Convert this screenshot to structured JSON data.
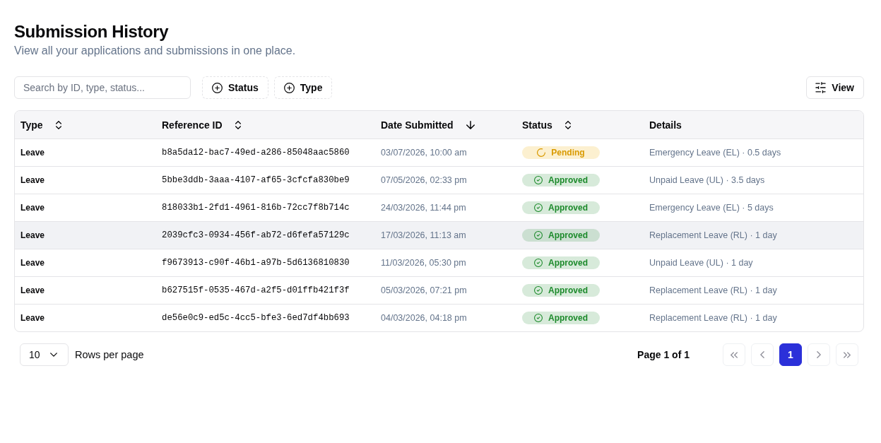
{
  "page": {
    "title": "Submission History",
    "subtitle": "View all your applications and submissions in one place."
  },
  "toolbar": {
    "search": {
      "placeholder": "Search by ID, type, status..."
    },
    "filters": [
      {
        "label": "Status"
      },
      {
        "label": "Type"
      }
    ],
    "view_button": {
      "label": "View"
    }
  },
  "table": {
    "columns": [
      {
        "label": "Type",
        "sortable": true,
        "sorted": false
      },
      {
        "label": "Reference ID",
        "sortable": true,
        "sorted": false
      },
      {
        "label": "Date Submitted",
        "sortable": true,
        "sorted": true
      },
      {
        "label": "Status",
        "sortable": true,
        "sorted": false
      },
      {
        "label": "Details",
        "sortable": false
      }
    ],
    "rows": [
      {
        "type": "Leave",
        "reference_id": "b8a5da12-bac7-49ed-a286-85048aac5860",
        "date_submitted": "03/07/2026, 10:00 am",
        "status": {
          "kind": "pending",
          "label": "Pending"
        },
        "details": "Emergency Leave (EL) · 0.5 days",
        "selected": false
      },
      {
        "type": "Leave",
        "reference_id": "5bbe3ddb-3aaa-4107-af65-3cfcfa830be9",
        "date_submitted": "07/05/2026, 02:33 pm",
        "status": {
          "kind": "approved",
          "label": "Approved"
        },
        "details": "Unpaid Leave (UL) · 3.5 days",
        "selected": false
      },
      {
        "type": "Leave",
        "reference_id": "818033b1-2fd1-4961-816b-72cc7f8b714c",
        "date_submitted": "24/03/2026, 11:44 pm",
        "status": {
          "kind": "approved",
          "label": "Approved"
        },
        "details": "Emergency Leave (EL) · 5 days",
        "selected": false
      },
      {
        "type": "Leave",
        "reference_id": "2039cfc3-0934-456f-ab72-d6fefa57129c",
        "date_submitted": "17/03/2026, 11:13 am",
        "status": {
          "kind": "approved",
          "label": "Approved"
        },
        "details": "Replacement Leave (RL) · 1 day",
        "selected": true
      },
      {
        "type": "Leave",
        "reference_id": "f9673913-c90f-46b1-a97b-5d6136810830",
        "date_submitted": "11/03/2026, 05:30 pm",
        "status": {
          "kind": "approved",
          "label": "Approved"
        },
        "details": "Unpaid Leave (UL) · 1 day",
        "selected": false
      },
      {
        "type": "Leave",
        "reference_id": "b627515f-0535-467d-a2f5-d01ffb421f3f",
        "date_submitted": "05/03/2026, 07:21 pm",
        "status": {
          "kind": "approved",
          "label": "Approved"
        },
        "details": "Replacement Leave (RL) · 1 day",
        "selected": false
      },
      {
        "type": "Leave",
        "reference_id": "de56e0c9-ed5c-4cc5-bfe3-6ed7df4bb693",
        "date_submitted": "04/03/2026, 04:18 pm",
        "status": {
          "kind": "approved",
          "label": "Approved"
        },
        "details": "Replacement Leave (RL) · 1 day",
        "selected": false
      }
    ]
  },
  "pagination": {
    "rows_per_page": {
      "value": "10",
      "label": "Rows per page"
    },
    "page_label": "Page 1 of 1",
    "buttons": [
      {
        "kind": "first",
        "disabled": true
      },
      {
        "kind": "previous",
        "disabled": true
      },
      {
        "kind": "page",
        "label": "1",
        "selected": true
      },
      {
        "kind": "next",
        "disabled": true
      },
      {
        "kind": "last",
        "disabled": true
      }
    ]
  }
}
